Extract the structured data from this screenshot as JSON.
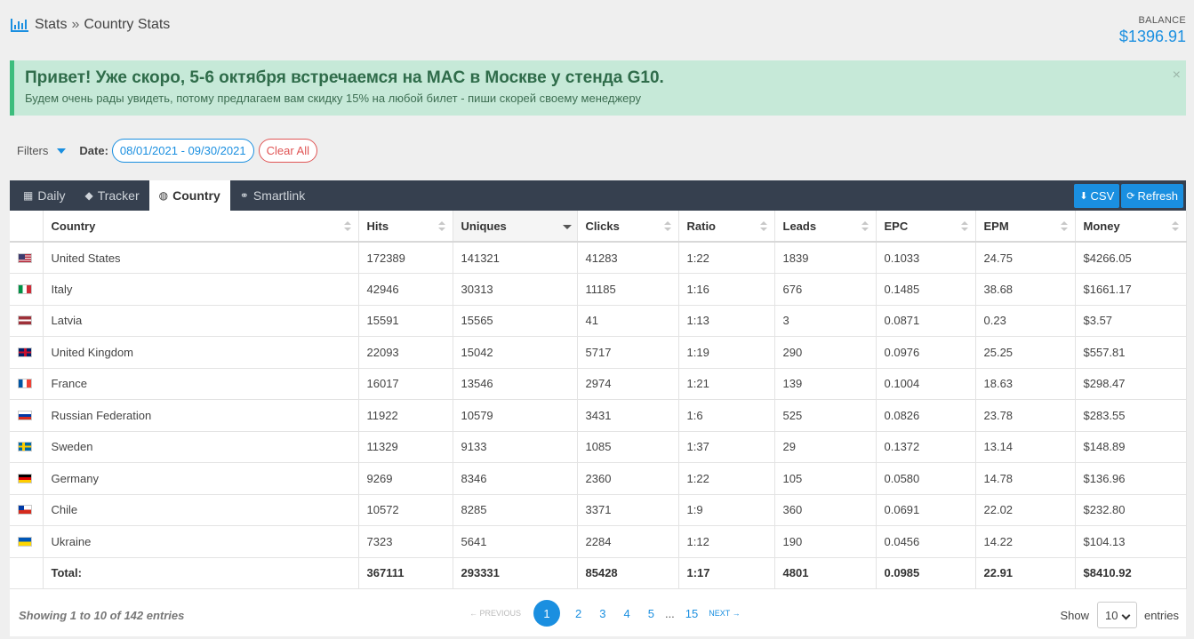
{
  "breadcrumb": {
    "root": "Stats",
    "separator": "»",
    "current": "Country Stats"
  },
  "balance": {
    "label": "BALANCE",
    "value": "$1396.91"
  },
  "alert": {
    "title": "Привет! Уже скоро, 5-6 октября встречаемся на MAC в Москве у стенда G10.",
    "text": "Будем очень рады увидеть, потому предлагаем вам скидку 15% на любой билет - пиши скорей своему менеджеру",
    "close": "×"
  },
  "filters": {
    "label": "Filters",
    "date_label": "Date:",
    "date_value": "08/01/2021 - 09/30/2021",
    "clear_label": "Clear All"
  },
  "tabs": [
    {
      "label": "Daily",
      "icon": "calendar-icon"
    },
    {
      "label": "Tracker",
      "icon": "tag-icon"
    },
    {
      "label": "Country",
      "icon": "globe-icon"
    },
    {
      "label": "Smartlink",
      "icon": "link-icon"
    }
  ],
  "buttons": {
    "csv": "CSV",
    "refresh": "Refresh"
  },
  "table": {
    "columns": [
      "Country",
      "Hits",
      "Uniques",
      "Clicks",
      "Ratio",
      "Leads",
      "EPC",
      "EPM",
      "Money"
    ],
    "rows": [
      {
        "flag": "us",
        "country": "United States",
        "hits": "172389",
        "uniques": "141321",
        "clicks": "41283",
        "ratio": "1:22",
        "leads": "1839",
        "epc": "0.1033",
        "epm": "24.75",
        "money": "$4266.05"
      },
      {
        "flag": "it",
        "country": "Italy",
        "hits": "42946",
        "uniques": "30313",
        "clicks": "11185",
        "ratio": "1:16",
        "leads": "676",
        "epc": "0.1485",
        "epm": "38.68",
        "money": "$1661.17"
      },
      {
        "flag": "lv",
        "country": "Latvia",
        "hits": "15591",
        "uniques": "15565",
        "clicks": "41",
        "ratio": "1:13",
        "leads": "3",
        "epc": "0.0871",
        "epm": "0.23",
        "money": "$3.57"
      },
      {
        "flag": "gb",
        "country": "United Kingdom",
        "hits": "22093",
        "uniques": "15042",
        "clicks": "5717",
        "ratio": "1:19",
        "leads": "290",
        "epc": "0.0976",
        "epm": "25.25",
        "money": "$557.81"
      },
      {
        "flag": "fr",
        "country": "France",
        "hits": "16017",
        "uniques": "13546",
        "clicks": "2974",
        "ratio": "1:21",
        "leads": "139",
        "epc": "0.1004",
        "epm": "18.63",
        "money": "$298.47"
      },
      {
        "flag": "ru",
        "country": "Russian Federation",
        "hits": "11922",
        "uniques": "10579",
        "clicks": "3431",
        "ratio": "1:6",
        "leads": "525",
        "epc": "0.0826",
        "epm": "23.78",
        "money": "$283.55"
      },
      {
        "flag": "se",
        "country": "Sweden",
        "hits": "11329",
        "uniques": "9133",
        "clicks": "1085",
        "ratio": "1:37",
        "leads": "29",
        "epc": "0.1372",
        "epm": "13.14",
        "money": "$148.89"
      },
      {
        "flag": "de",
        "country": "Germany",
        "hits": "9269",
        "uniques": "8346",
        "clicks": "2360",
        "ratio": "1:22",
        "leads": "105",
        "epc": "0.0580",
        "epm": "14.78",
        "money": "$136.96"
      },
      {
        "flag": "cl",
        "country": "Chile",
        "hits": "10572",
        "uniques": "8285",
        "clicks": "3371",
        "ratio": "1:9",
        "leads": "360",
        "epc": "0.0691",
        "epm": "22.02",
        "money": "$232.80"
      },
      {
        "flag": "ua",
        "country": "Ukraine",
        "hits": "7323",
        "uniques": "5641",
        "clicks": "2284",
        "ratio": "1:12",
        "leads": "190",
        "epc": "0.0456",
        "epm": "14.22",
        "money": "$104.13"
      }
    ],
    "total": {
      "label": "Total:",
      "hits": "367111",
      "uniques": "293331",
      "clicks": "85428",
      "ratio": "1:17",
      "leads": "4801",
      "epc": "0.0985",
      "epm": "22.91",
      "money": "$8410.92"
    }
  },
  "footer": {
    "info": "Showing 1 to 10 of 142 entries",
    "prev": "← PREVIOUS",
    "next": "NEXT →",
    "pages": [
      "1",
      "2",
      "3",
      "4",
      "5"
    ],
    "dots": "...",
    "last_page": "15",
    "show_label": "Show",
    "page_size": "10",
    "entries_label": "entries"
  },
  "colors": {
    "accent": "#1a8fe0",
    "tabbar": "#36404f",
    "alert_bg": "#c6e9d8",
    "danger": "#e05555"
  }
}
